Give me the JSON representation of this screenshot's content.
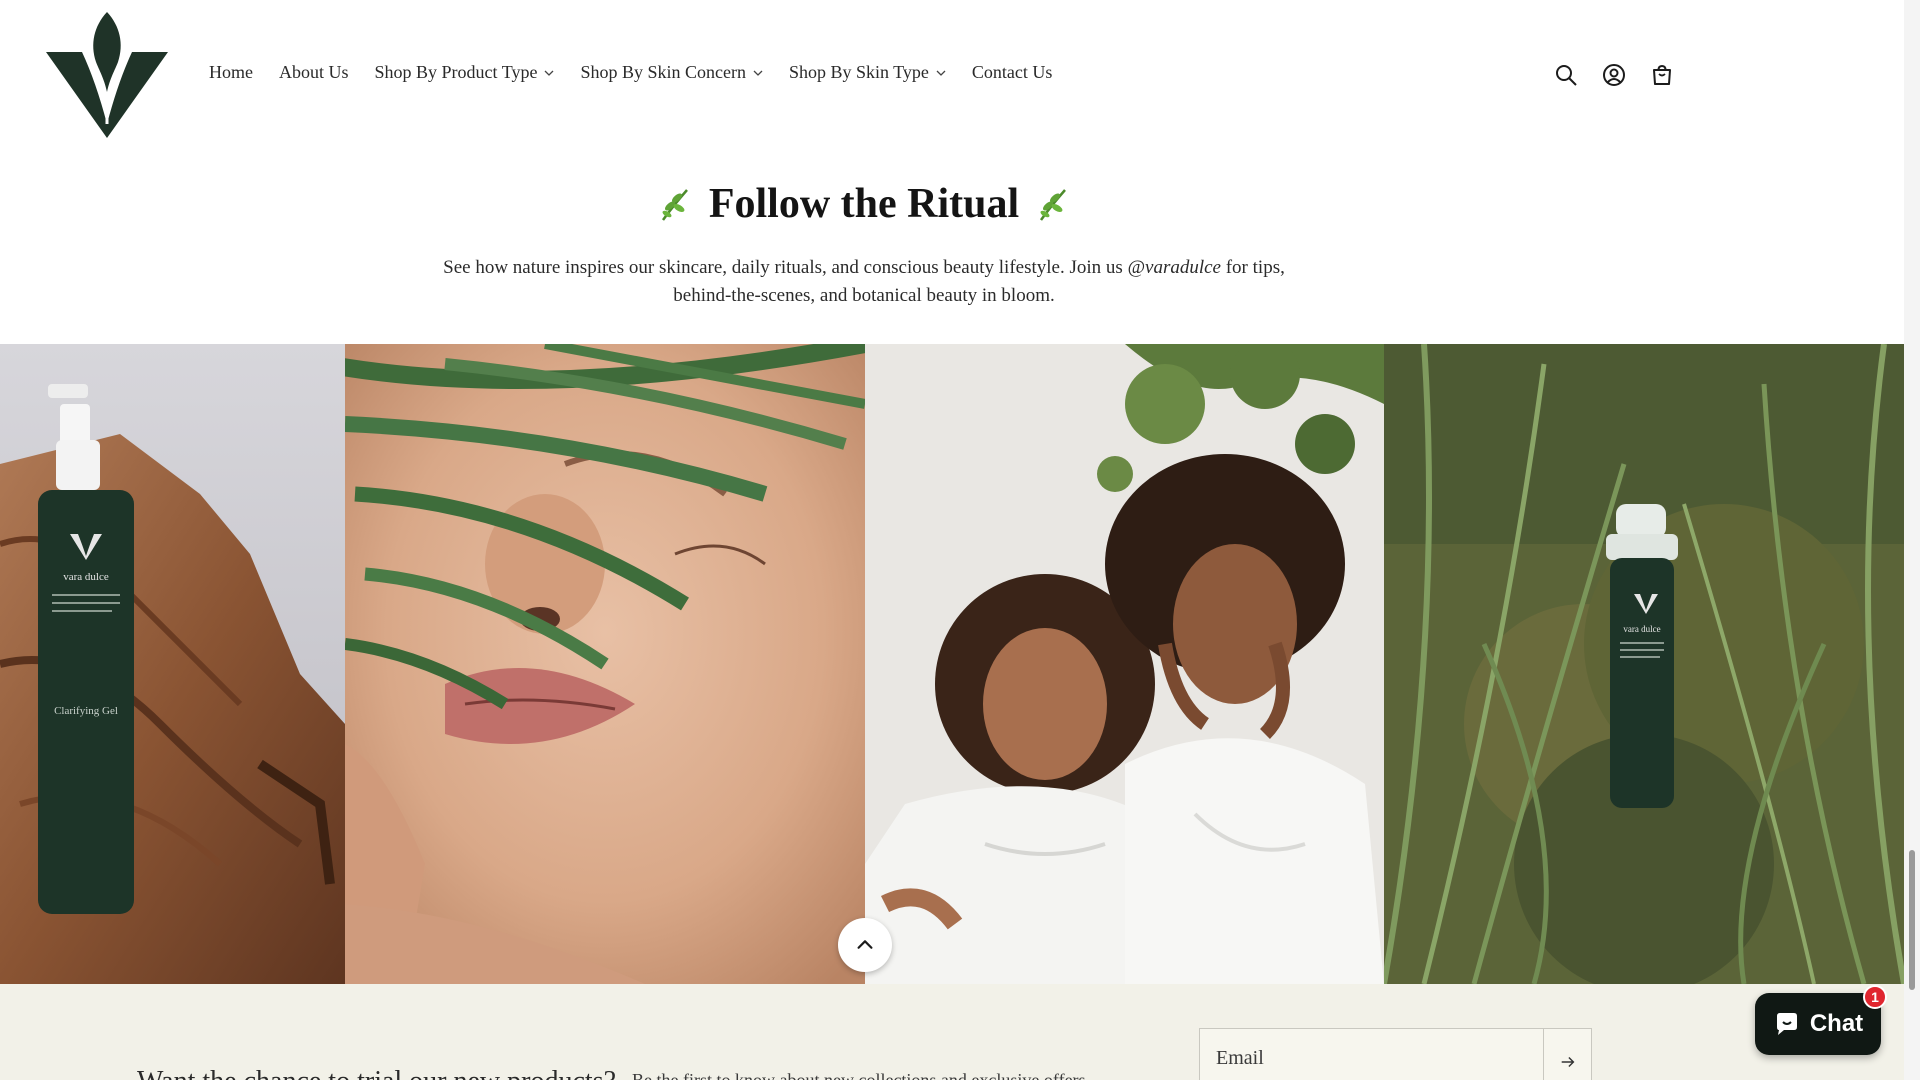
{
  "header": {
    "nav": [
      {
        "label": "Home",
        "dropdown": false
      },
      {
        "label": "About Us",
        "dropdown": false
      },
      {
        "label": "Shop By Product Type",
        "dropdown": true
      },
      {
        "label": "Shop By Skin Concern",
        "dropdown": true
      },
      {
        "label": "Shop By Skin Type",
        "dropdown": true
      },
      {
        "label": "Contact Us",
        "dropdown": false
      }
    ],
    "icons": [
      "search-icon",
      "account-icon",
      "cart-icon"
    ],
    "brand_color": "#1f3328"
  },
  "ritual": {
    "title": "Follow the Ritual",
    "desc_before": "See how nature inspires our skincare, daily rituals, and conscious beauty lifestyle. Join us",
    "handle": "@varadulce",
    "desc_after": "for tips, behind-the-scenes, and botanical beauty in bloom."
  },
  "gallery": {
    "tiles": [
      {
        "bottle_brand": "vara dulce",
        "bottle_label": "Clarifying Gel"
      },
      {},
      {},
      {
        "bottle_brand": "vara dulce"
      }
    ]
  },
  "newsletter": {
    "heading": "Want the chance to trial our new products?",
    "subtext": "Be the first to know about new collections and exclusive offers.",
    "email_label": "Email"
  },
  "chat": {
    "label": "Chat",
    "badge": "1"
  }
}
